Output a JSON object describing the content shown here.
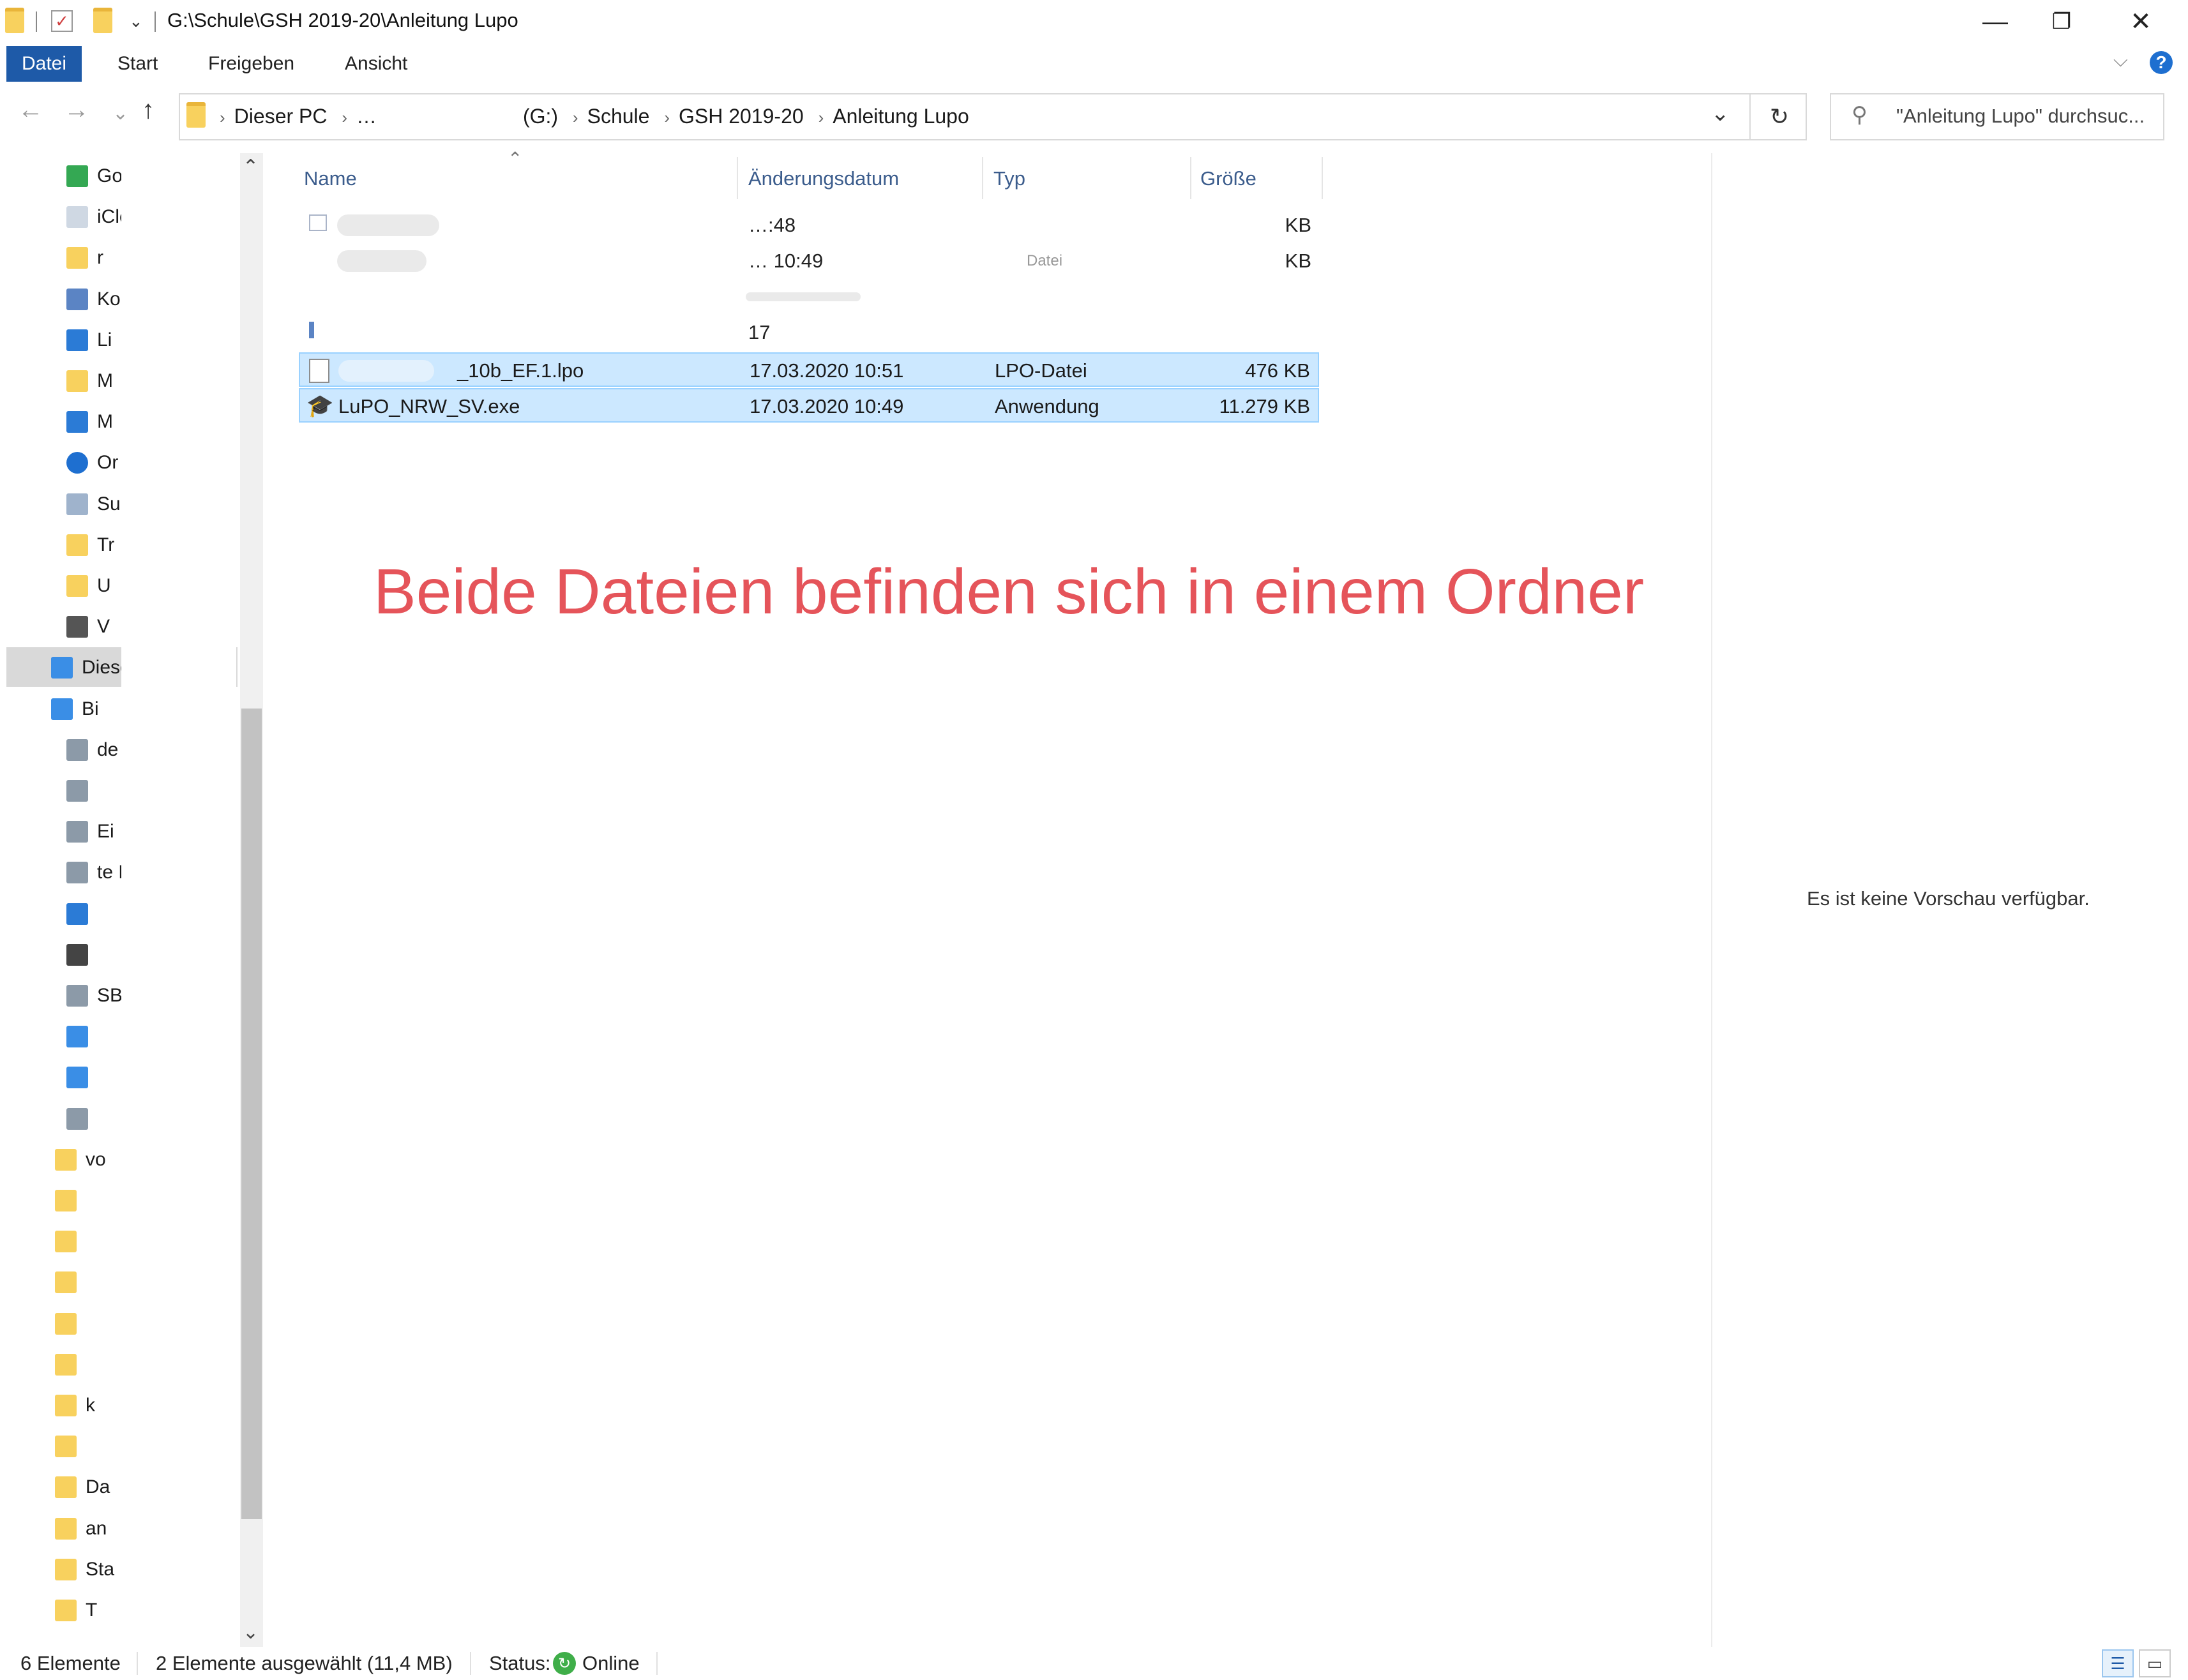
{
  "window": {
    "title_path": "G:\\Schule\\GSH 2019-20\\Anleitung Lupo",
    "minimize": "—",
    "restore": "❐",
    "close": "✕"
  },
  "ribbon": {
    "file_tab": "Datei",
    "tabs": [
      "Start",
      "Freigeben",
      "Ansicht"
    ],
    "help": "?",
    "collapse": "⌵"
  },
  "nav_buttons": {
    "back": "←",
    "forward": "→",
    "recent": "⌄",
    "up": "↑"
  },
  "address": {
    "crumbs": [
      "Dieser PC",
      "…",
      "(G:)",
      "Schule",
      "GSH 2019-20",
      "Anleitung Lupo"
    ],
    "dropdown": "⌄",
    "refresh": "↻"
  },
  "search": {
    "placeholder": "\"Anleitung Lupo\" durchsuc..."
  },
  "nav_pane": {
    "items": [
      {
        "label": "Google Dri",
        "icon": "google-drive-icon"
      },
      {
        "label": "iCloud Drive",
        "icon": "icloud-icon"
      },
      {
        "label": "r",
        "icon": "folder-icon"
      },
      {
        "label": "Kontakte",
        "icon": "contacts-icon"
      },
      {
        "label": "Li",
        "icon": "link-icon"
      },
      {
        "label": "M",
        "icon": "folder-icon"
      },
      {
        "label": "M",
        "icon": "music-icon"
      },
      {
        "label": "Or",
        "icon": "onedrive-icon"
      },
      {
        "label": "Suchvorgänge",
        "icon": "search-folder-icon"
      },
      {
        "label": "Tr",
        "icon": "folder-icon"
      },
      {
        "label": "U",
        "icon": "folder-icon"
      },
      {
        "label": "V",
        "icon": "video-icon"
      },
      {
        "label": "Dieser PC",
        "icon": "computer-icon"
      },
      {
        "label": "Bi",
        "icon": "pictures-icon"
      },
      {
        "label": "de",
        "icon": "drive-icon"
      },
      {
        "label": "",
        "icon": "document-icon"
      },
      {
        "label": "Ei",
        "icon": "drive-icon"
      },
      {
        "label": "te Bi",
        "icon": "drive-icon"
      },
      {
        "label": "",
        "icon": "music-icon"
      },
      {
        "label": "",
        "icon": "flag-icon"
      },
      {
        "label": "SB",
        "icon": "usb-icon"
      },
      {
        "label": "",
        "icon": "network-icon"
      },
      {
        "label": "",
        "icon": "control-panel-icon"
      },
      {
        "label": "",
        "icon": "recycle-bin-icon"
      },
      {
        "label": "vo",
        "icon": "folder-icon"
      },
      {
        "label": "",
        "icon": "folder-icon"
      },
      {
        "label": "",
        "icon": "folder-icon"
      },
      {
        "label": "",
        "icon": "folder-icon"
      },
      {
        "label": "",
        "icon": "folder-icon"
      },
      {
        "label": "",
        "icon": "folder-icon"
      },
      {
        "label": "k",
        "icon": "folder-icon"
      },
      {
        "label": "",
        "icon": "folder-icon"
      },
      {
        "label": "Da",
        "icon": "folder-icon"
      },
      {
        "label": "an",
        "icon": "folder-icon"
      },
      {
        "label": "Sta",
        "icon": "folder-icon"
      },
      {
        "label": "T",
        "icon": "folder-icon"
      }
    ]
  },
  "columns": {
    "name": "Name",
    "date": "Änderungsdatum",
    "type": "Typ",
    "size": "Größe"
  },
  "files": [
    {
      "name": "",
      "date": "…:48",
      "type": "",
      "size": "KB",
      "selected": false
    },
    {
      "name": "",
      "date": "… 10:49",
      "type": "Datei",
      "size": "KB",
      "selected": false
    },
    {
      "name": "",
      "date": "",
      "type": "",
      "size": "",
      "selected": false
    },
    {
      "name": "",
      "date": "17",
      "type": "",
      "size": "",
      "selected": false
    },
    {
      "name": "_10b_EF.1.lpo",
      "date": "17.03.2020 10:51",
      "type": "LPO-Datei",
      "size": "476 KB",
      "selected": true,
      "icon": "file-icon"
    },
    {
      "name": "LuPO_NRW_SV.exe",
      "date": "17.03.2020 10:49",
      "type": "Anwendung",
      "size": "11.279 KB",
      "selected": true,
      "icon": "graduation-cap-icon"
    }
  ],
  "callout": "Beide Dateien befinden sich in einem Ordner",
  "preview": {
    "message": "Es ist keine Vorschau verfügbar."
  },
  "status": {
    "count": "6 Elemente",
    "selected": "2 Elemente ausgewählt (11,4 MB)",
    "status_label": "Status:",
    "status_value": "Online"
  },
  "colors": {
    "accent": "#1e5aa8",
    "selection": "#cce8ff",
    "callout": "#e5545a",
    "folder": "#f8d15e"
  }
}
